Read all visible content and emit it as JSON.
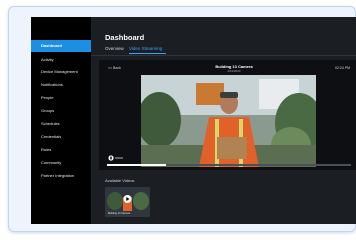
{
  "sidebar": {
    "items": [
      {
        "label": "Dashboard",
        "active": true
      },
      {
        "label": "Activity"
      },
      {
        "label": "Device Management"
      },
      {
        "label": "Notifications"
      },
      {
        "label": "People"
      },
      {
        "label": "Groups"
      },
      {
        "label": "Schedules"
      },
      {
        "label": "Credentials"
      },
      {
        "label": "Roles"
      },
      {
        "label": "Community"
      },
      {
        "label": "Partner Integration"
      }
    ]
  },
  "header": {
    "title": "Dashboard"
  },
  "tabs": [
    {
      "label": "Overview"
    },
    {
      "label": "Video Streaming",
      "active": true
    }
  ],
  "player": {
    "back_label": "<< Back",
    "camera_title": "Building 13 Camera",
    "date": "4/11/2023",
    "time": "02:24 PM",
    "progress": 0.24
  },
  "available": {
    "heading": "Available Videos",
    "thumbnail_label": "Building 13 Camera"
  },
  "colors": {
    "accent": "#1d8fe3",
    "background": "#1b1f24",
    "sidebar": "#000000"
  }
}
